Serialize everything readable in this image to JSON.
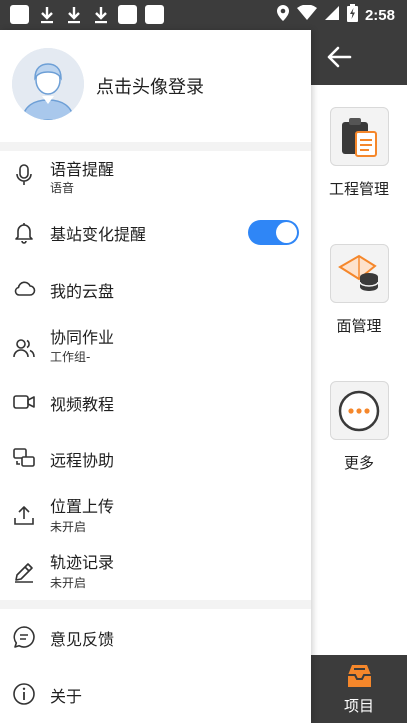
{
  "status_bar": {
    "time": "2:58",
    "left_icons": [
      "app-icon",
      "download-icon",
      "download-icon",
      "download-icon",
      "app-icon",
      "app-icon"
    ],
    "right_icons": [
      "location-icon",
      "wifi-icon",
      "signal-icon",
      "battery-charging-icon"
    ]
  },
  "profile": {
    "login_text": "点击头像登录",
    "avatar_icon": "user-avatar-icon"
  },
  "menu": {
    "voice_reminder": {
      "label": "语音提醒",
      "sub": "语音",
      "icon": "microphone-icon"
    },
    "station_change": {
      "label": "基站变化提醒",
      "icon": "bell-icon",
      "toggle_on": true
    },
    "cloud_disk": {
      "label": "我的云盘",
      "icon": "cloud-icon"
    },
    "collaboration": {
      "label": "协同作业",
      "sub": "工作组-",
      "icon": "people-icon"
    },
    "video_tutorial": {
      "label": "视频教程",
      "icon": "video-camera-icon"
    },
    "remote_assist": {
      "label": "远程协助",
      "icon": "remote-screens-icon"
    },
    "location_upload": {
      "label": "位置上传",
      "sub": "未开启",
      "icon": "upload-icon"
    },
    "track_record": {
      "label": "轨迹记录",
      "sub": "未开启",
      "icon": "pen-icon"
    },
    "feedback": {
      "label": "意见反馈",
      "icon": "feedback-icon"
    },
    "about": {
      "label": "关于",
      "icon": "info-icon"
    }
  },
  "right_panel": {
    "tiles": [
      {
        "label": "工程管理",
        "icon": "clipboard-icon"
      },
      {
        "label": "面管理",
        "icon": "surface-layers-icon"
      },
      {
        "label": "更多",
        "icon": "more-icon"
      }
    ],
    "bottom_tab": {
      "label": "项目",
      "icon": "inbox-tray-icon"
    }
  },
  "colors": {
    "dark_bar": "#3c3c3c",
    "toggle_accent": "#2f86f6",
    "orange_accent": "#f5872b",
    "divider": "#f3f3f3"
  }
}
